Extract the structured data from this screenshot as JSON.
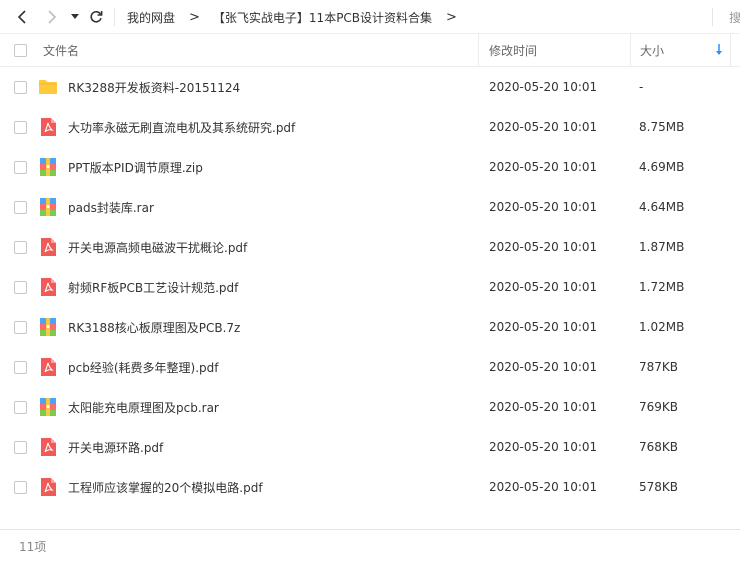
{
  "nav": {
    "back_icon": "chevron-left-icon",
    "forward_icon": "chevron-right-icon",
    "history_icon": "caret-down-icon",
    "refresh_icon": "refresh-icon",
    "breadcrumb": [
      "我的网盘",
      "【张飞实战电子】11本PCB设计资料合集"
    ],
    "separator": ">",
    "search_placeholder": "搜"
  },
  "header": {
    "name": "文件名",
    "modified": "修改时间",
    "size": "大小",
    "sort_icon": "sort-down-arrow-icon"
  },
  "files": [
    {
      "name": "RK3288开发板资料-20151124",
      "type": "folder",
      "modified": "2020-05-20 10:01",
      "size": "-"
    },
    {
      "name": "大功率永磁无刷直流电机及其系统研究.pdf",
      "type": "pdf",
      "modified": "2020-05-20 10:01",
      "size": "8.75MB"
    },
    {
      "name": "PPT版本PID调节原理.zip",
      "type": "archive",
      "modified": "2020-05-20 10:01",
      "size": "4.69MB"
    },
    {
      "name": "pads封装库.rar",
      "type": "archive",
      "modified": "2020-05-20 10:01",
      "size": "4.64MB"
    },
    {
      "name": "开关电源高频电磁波干扰概论.pdf",
      "type": "pdf",
      "modified": "2020-05-20 10:01",
      "size": "1.87MB"
    },
    {
      "name": "射频RF板PCB工艺设计规范.pdf",
      "type": "pdf",
      "modified": "2020-05-20 10:01",
      "size": "1.72MB"
    },
    {
      "name": "RK3188核心板原理图及PCB.7z",
      "type": "archive",
      "modified": "2020-05-20 10:01",
      "size": "1.02MB"
    },
    {
      "name": "pcb经验(耗费多年整理).pdf",
      "type": "pdf",
      "modified": "2020-05-20 10:01",
      "size": "787KB"
    },
    {
      "name": "太阳能充电原理图及pcb.rar",
      "type": "archive",
      "modified": "2020-05-20 10:01",
      "size": "769KB"
    },
    {
      "name": "开关电源环路.pdf",
      "type": "pdf",
      "modified": "2020-05-20 10:01",
      "size": "768KB"
    },
    {
      "name": "工程师应该掌握的20个模拟电路.pdf",
      "type": "pdf",
      "modified": "2020-05-20 10:01",
      "size": "578KB"
    }
  ],
  "footer": {
    "count": "11项"
  },
  "colors": {
    "folder": "#ffc93c",
    "pdf": "#f05a57",
    "archive_top": "#4aa6f2",
    "archive_mid": "#ff6b6b",
    "archive_bottom": "#7ccb4e",
    "accent": "#2f8ff5"
  }
}
